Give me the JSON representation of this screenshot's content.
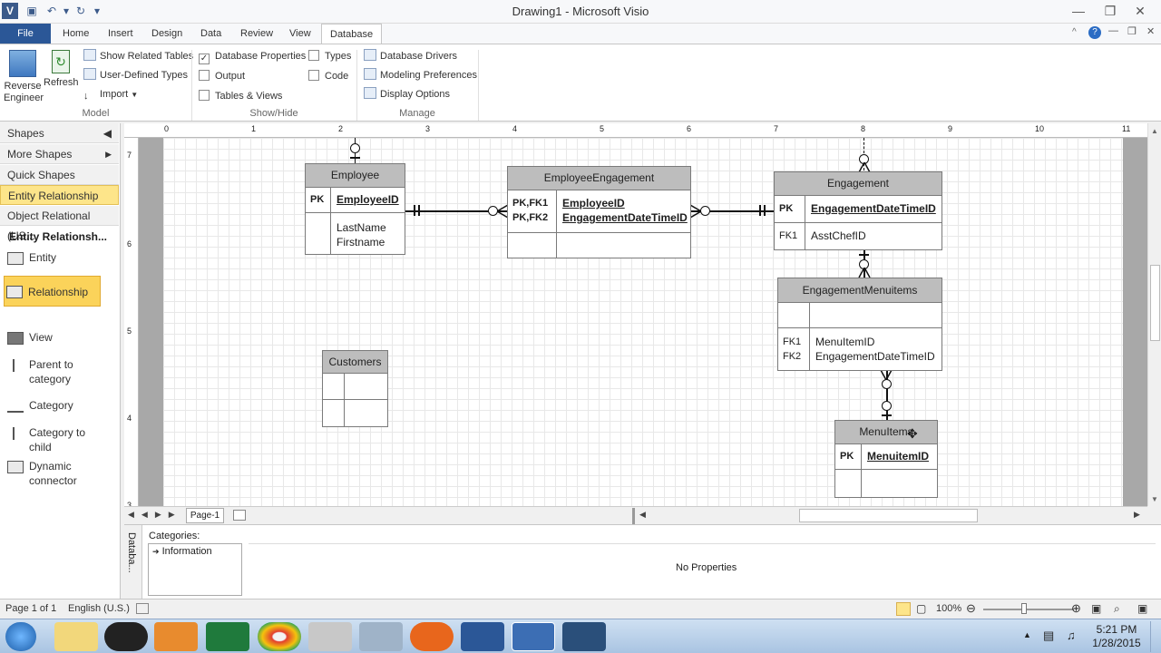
{
  "window": {
    "title": "Drawing1  -  Microsoft Visio"
  },
  "tabs": [
    "File",
    "Home",
    "Insert",
    "Design",
    "Data",
    "Review",
    "View",
    "Database"
  ],
  "active_tab": "Database",
  "ribbon": {
    "model": {
      "reverse_engineer": "Reverse Engineer",
      "refresh": "Refresh",
      "show_related_tables": "Show Related Tables",
      "user_defined_types": "User-Defined Types",
      "import": "Import",
      "group": "Model"
    },
    "showhide": {
      "database_properties": "Database Properties",
      "types": "Types",
      "output": "Output",
      "code": "Code",
      "tables_views": "Tables & Views",
      "group": "Show/Hide",
      "database_properties_checked": true
    },
    "manage": {
      "database_drivers": "Database Drivers",
      "modeling_preferences": "Modeling Preferences",
      "display_options": "Display Options",
      "group": "Manage"
    }
  },
  "shapes_pane": {
    "title": "Shapes",
    "more_shapes": "More Shapes",
    "quick_shapes": "Quick Shapes",
    "stencils": [
      "Entity Relationship (U...",
      "Object Relational (US..."
    ],
    "section_title": "Entity Relationsh...",
    "items": [
      "Entity",
      "Relationship",
      "View",
      "Parent to category",
      "Category",
      "Category to child",
      "Dynamic connector"
    ]
  },
  "ruler": {
    "top": [
      "0",
      "1",
      "2",
      "3",
      "4",
      "5",
      "6",
      "7",
      "8",
      "9",
      "10",
      "11"
    ],
    "left": [
      "7",
      "6",
      "5",
      "4",
      "3"
    ]
  },
  "entities": {
    "employee": {
      "name": "Employee",
      "pk_label": "PK",
      "pk": "EmployeeID",
      "attrs": [
        "LastName",
        "Firstname"
      ]
    },
    "employee_engagement": {
      "name": "EmployeeEngagement",
      "key_labels": [
        "PK,FK1",
        "PK,FK2"
      ],
      "pks": [
        "EmployeeID",
        "EngagementDateTimeID"
      ]
    },
    "engagement": {
      "name": "Engagement",
      "pk_label": "PK",
      "pk": "EngagementDateTimeID",
      "fk_label": "FK1",
      "fk": "AsstChefID"
    },
    "engagement_menuitems": {
      "name": "EngagementMenuitems",
      "fk_labels": [
        "FK1",
        "FK2"
      ],
      "fks": [
        "MenuItemID",
        "EngagementDateTimeID"
      ]
    },
    "customers": {
      "name": "Customers"
    },
    "menuitems": {
      "name": "MenuItems",
      "pk_label": "PK",
      "pk": "MenuitemID"
    }
  },
  "page_tabs": {
    "current": "Page-1"
  },
  "properties": {
    "side_label": "Databa...",
    "categories_label": "Categories:",
    "category": "Information",
    "no_properties": "No Properties"
  },
  "status": {
    "page": "Page 1 of 1",
    "language": "English (U.S.)",
    "zoom": "100%"
  },
  "clock": {
    "time": "5:21 PM",
    "date": "1/28/2015"
  },
  "colors": {
    "file_tab": "#2b5797",
    "selected_stencil": "#fde58a",
    "entity_header": "#bdbdbd"
  }
}
